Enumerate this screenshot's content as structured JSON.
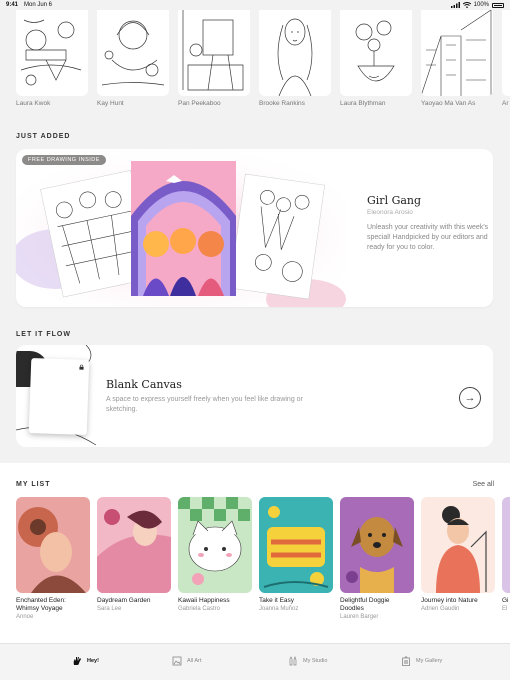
{
  "status_bar": {
    "time": "9:41",
    "date": "Mon Jun 6",
    "battery": "100%"
  },
  "featured_artists": [
    {
      "name": "Laura Kwok"
    },
    {
      "name": "Kay Hunt"
    },
    {
      "name": "Pan Peekaboo"
    },
    {
      "name": "Brooke Rankins"
    },
    {
      "name": "Laura Blythman"
    },
    {
      "name": "Yaoyao Ma Van As"
    },
    {
      "name": "Ar"
    }
  ],
  "just_added": {
    "section_label": "JUST ADDED",
    "badge": "FREE DRAWING INSIDE",
    "title": "Girl Gang",
    "author": "Eleonora Arosio",
    "description": "Unleash your creativity with this week's special! Handpicked by our editors and ready for you to color."
  },
  "let_it_flow": {
    "section_label": "LET IT FLOW",
    "title": "Blank Canvas",
    "description": "A space to express yourself freely when you feel like drawing or sketching.",
    "arrow_icon": "arrow-right-icon"
  },
  "my_list": {
    "section_label": "MY LIST",
    "see_all": "See all",
    "items": [
      {
        "title": "Enchanted Eden: Whimsy Voyage",
        "artist": "Annoe",
        "color": "#e9a3a0"
      },
      {
        "title": "Daydream Garden",
        "artist": "Sara Lee",
        "color": "#f2b8c6"
      },
      {
        "title": "Kawaii Happiness",
        "artist": "Gabriela Castro",
        "color": "#c9e7c4"
      },
      {
        "title": "Take it Easy",
        "artist": "Joanna Muñoz",
        "color": "#3bb3b3"
      },
      {
        "title": "Delightful Doggie Doodles",
        "artist": "Lauren Barger",
        "color": "#a86bb8"
      },
      {
        "title": "Journey into Nature",
        "artist": "Adrien Gaudin",
        "color": "#e8735a"
      },
      {
        "title": "Gi",
        "artist": "El",
        "color": "#d9c3e6"
      }
    ]
  },
  "tab_bar": {
    "tabs": [
      {
        "label": "Hey!",
        "icon": "hand-icon",
        "active": true
      },
      {
        "label": "All Art",
        "icon": "gallery-icon",
        "active": false
      },
      {
        "label": "My Studio",
        "icon": "brushes-icon",
        "active": false
      },
      {
        "label": "My Gallery",
        "icon": "frame-icon",
        "active": false
      }
    ]
  }
}
